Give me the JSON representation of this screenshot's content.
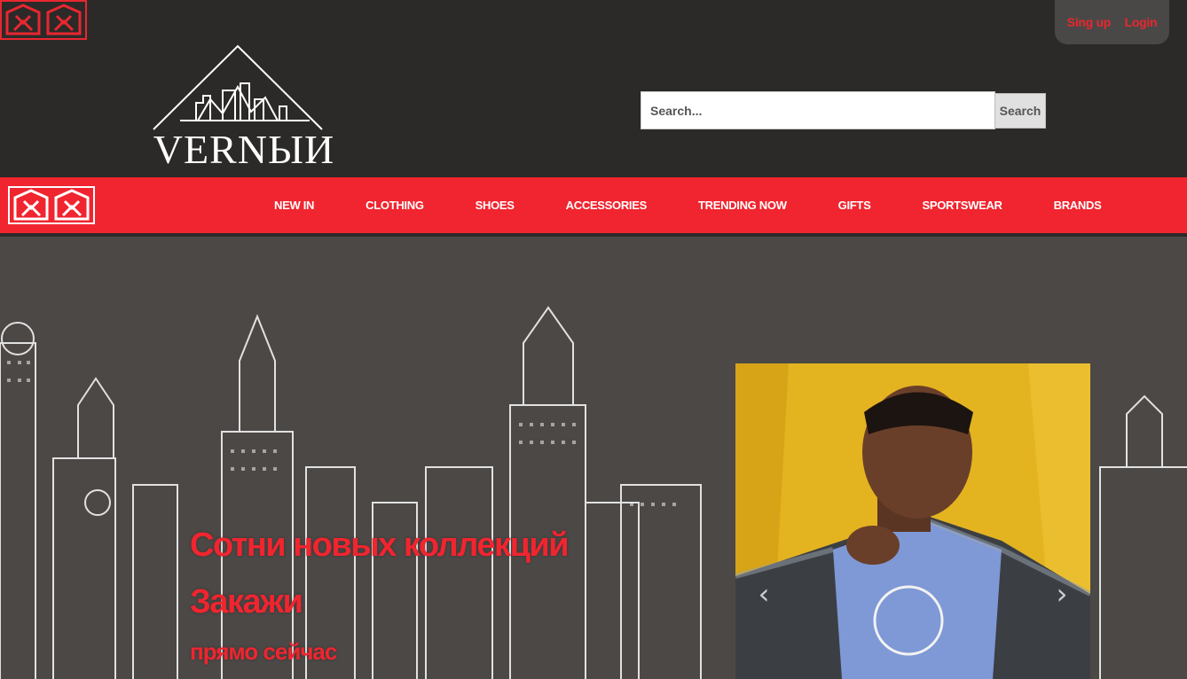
{
  "header": {
    "brand_name": "VERNЫИ",
    "auth": {
      "signup_label": "Sing up",
      "login_label": "Login"
    },
    "search": {
      "placeholder": "Search...",
      "button_label": "Search"
    }
  },
  "nav": {
    "items": [
      {
        "label": "NEW IN"
      },
      {
        "label": "CLOTHING"
      },
      {
        "label": "SHOES"
      },
      {
        "label": "ACCESSORIES"
      },
      {
        "label": "TRENDING NOW"
      },
      {
        "label": "GIFTS"
      },
      {
        "label": "SPORTSWEAR"
      },
      {
        "label": "BRANDS"
      }
    ]
  },
  "hero": {
    "title": "Сотни новых коллекций",
    "subtitle": "Закажи",
    "small": "прямо сейчас",
    "carousel": {
      "prev_icon": "chevron-left-icon",
      "next_icon": "chevron-right-icon"
    }
  },
  "colors": {
    "accent": "#f0252f",
    "header_bg": "#2b2a28",
    "hero_bg": "#4b4846"
  }
}
